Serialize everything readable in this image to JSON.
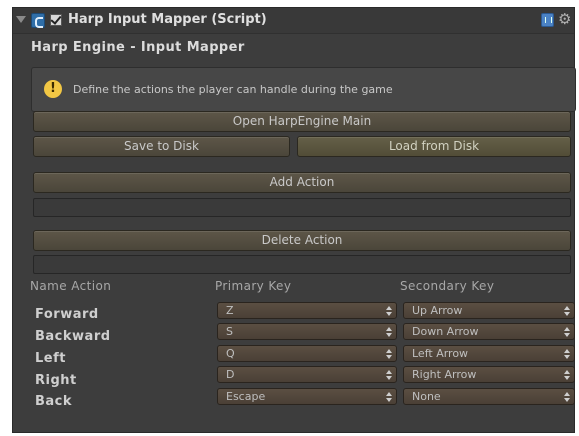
{
  "header": {
    "title": "Harp Input Mapper (Script)",
    "enabled": true,
    "icons": [
      "foldout-arrow-icon",
      "script-icon",
      "help-icon",
      "gear-icon"
    ]
  },
  "section_title": "Harp Engine - Input Mapper",
  "info": {
    "icon": "info-icon",
    "text": "Define the actions the player can handle during the game"
  },
  "buttons": {
    "open_main": "Open HarpEngine Main",
    "save_disk": "Save to Disk",
    "load_disk": "Load from Disk",
    "add_action": "Add Action",
    "delete_action": "Delete Action"
  },
  "fields": {
    "add_action_value": "",
    "delete_action_value": ""
  },
  "table": {
    "headers": {
      "name": "Name Action",
      "primary": "Primary Key",
      "secondary": "Secondary Key"
    },
    "rows": [
      {
        "name": "Forward",
        "primary": "Z",
        "secondary": "Up Arrow"
      },
      {
        "name": "Backward",
        "primary": "S",
        "secondary": "Down Arrow"
      },
      {
        "name": "Left",
        "primary": "Q",
        "secondary": "Left Arrow"
      },
      {
        "name": "Right",
        "primary": "D",
        "secondary": "Right Arrow"
      },
      {
        "name": "Back",
        "primary": "Escape",
        "secondary": "None"
      }
    ]
  },
  "colors": {
    "panel_bg": "#3d3d3d",
    "button_bg": "#564f42",
    "info_icon": "#f2c744"
  }
}
